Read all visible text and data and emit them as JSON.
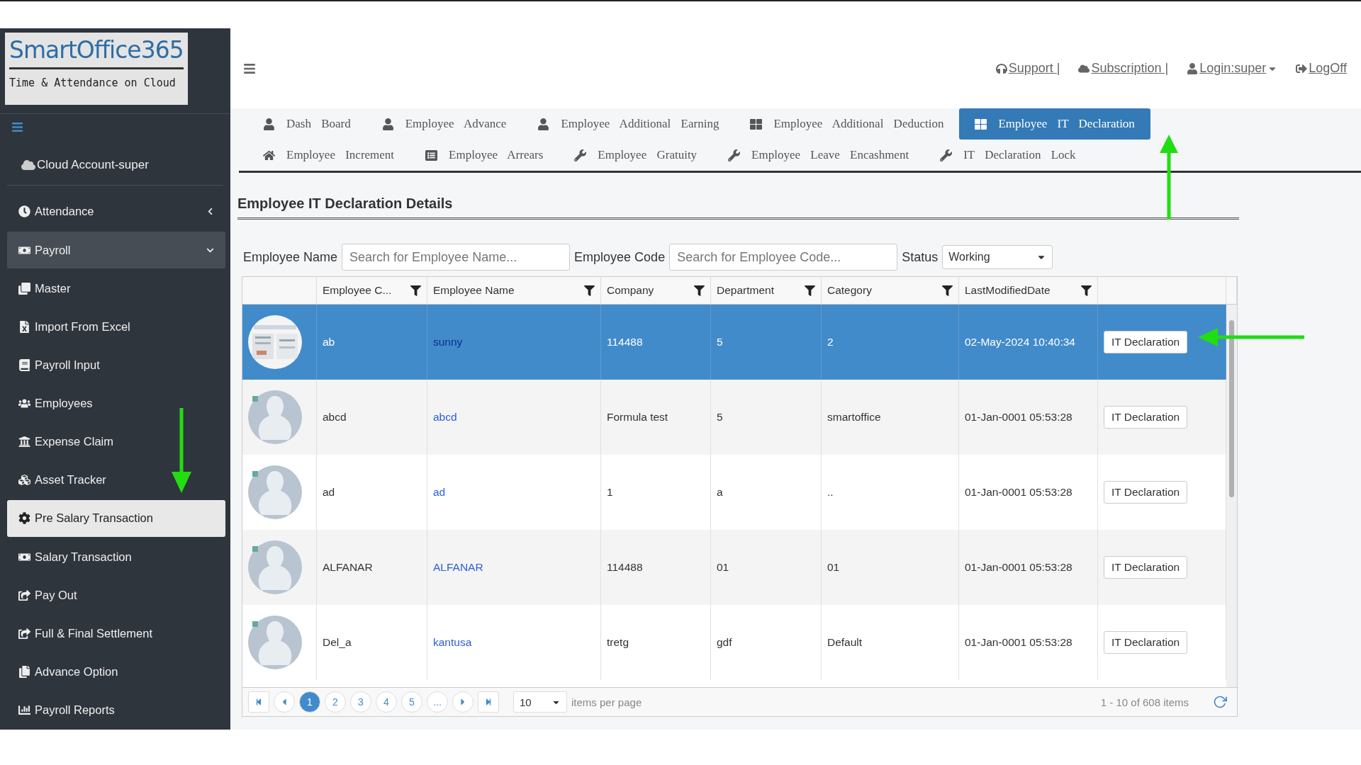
{
  "logo": {
    "title": "SmartOffice365",
    "subtitle": "Time & Attendance on Cloud"
  },
  "account": "Cloud Account-super",
  "sidebar": {
    "items": [
      {
        "label": "Attendance",
        "kind": "group",
        "expanded": false,
        "selected": false
      },
      {
        "label": "Payroll",
        "kind": "group",
        "expanded": true,
        "selected": true
      },
      {
        "label": "Master",
        "kind": "link",
        "selected": false
      },
      {
        "label": "Import From Excel",
        "kind": "link",
        "selected": false
      },
      {
        "label": "Payroll Input",
        "kind": "link",
        "selected": false
      },
      {
        "label": "Employees",
        "kind": "link",
        "selected": false
      },
      {
        "label": "Expense Claim",
        "kind": "link",
        "selected": false
      },
      {
        "label": "Asset Tracker",
        "kind": "link",
        "selected": false
      },
      {
        "label": "Pre Salary Transaction",
        "kind": "link",
        "selected": true
      },
      {
        "label": "Salary Transaction",
        "kind": "link",
        "selected": false
      },
      {
        "label": "Pay Out",
        "kind": "link",
        "selected": false
      },
      {
        "label": "Full & Final Settlement",
        "kind": "link",
        "selected": false
      },
      {
        "label": "Advance Option",
        "kind": "link",
        "selected": false
      },
      {
        "label": "Payroll Reports",
        "kind": "link",
        "selected": false
      }
    ]
  },
  "topbar": {
    "links": [
      "Support |",
      "Subscription |",
      "Login:super",
      "LogOff"
    ]
  },
  "tabs": [
    {
      "label": "Dash Board",
      "selected": false
    },
    {
      "label": "Employee Advance",
      "selected": false
    },
    {
      "label": "Employee Additional Earning",
      "selected": false
    },
    {
      "label": "Employee Additional Deduction",
      "selected": false
    },
    {
      "label": "Employee IT Declaration",
      "selected": true
    },
    {
      "label": "Employee Increment",
      "selected": false
    },
    {
      "label": "Employee Arrears",
      "selected": false
    },
    {
      "label": "Employee Gratuity",
      "selected": false
    },
    {
      "label": "Employee Leave Encashment",
      "selected": false
    },
    {
      "label": "IT Declaration Lock",
      "selected": false
    }
  ],
  "title": "Employee IT Declaration Details",
  "filters": {
    "name_label": "Employee Name",
    "name_placeholder": "Search for Employee Name...",
    "code_label": "Employee Code",
    "code_placeholder": "Search for Employee Code...",
    "status_label": "Status",
    "status_value": "Working"
  },
  "table": {
    "columns": [
      "Employee C...",
      "Employee Name",
      "Company",
      "Department",
      "Category",
      "LastModifiedDate"
    ],
    "rows": [
      {
        "kind": "picture",
        "code": "ab",
        "name": "sunny",
        "company": "114488",
        "department": "5",
        "category": "2",
        "date": "02-May-2024 10:40:34",
        "action": "IT Declaration",
        "selected": true
      },
      {
        "kind": "placeholder",
        "code": "abcd",
        "name": "abcd",
        "company": "Formula test",
        "department": "5",
        "category": "smartoffice",
        "date": "01-Jan-0001 05:53:28",
        "action": "IT Declaration",
        "selected": false
      },
      {
        "kind": "placeholder",
        "code": "ad",
        "name": "ad",
        "company": "1",
        "department": "a",
        "category": "..",
        "date": "01-Jan-0001 05:53:28",
        "action": "IT Declaration",
        "selected": false
      },
      {
        "kind": "placeholder",
        "code": "ALFANAR",
        "name": "ALFANAR",
        "company": "114488",
        "department": "01",
        "category": "01",
        "date": "01-Jan-0001 05:53:28",
        "action": "IT Declaration",
        "selected": false
      },
      {
        "kind": "placeholder",
        "code": "Del_a",
        "name": "kantusa",
        "company": "tretg",
        "department": "gdf",
        "category": "Default",
        "date": "01-Jan-0001 05:53:28",
        "action": "IT Declaration",
        "selected": false
      }
    ]
  },
  "pager": {
    "pages": [
      {
        "label": "1",
        "selected": true
      },
      {
        "label": "2",
        "selected": false
      },
      {
        "label": "3",
        "selected": false
      },
      {
        "label": "4",
        "selected": false
      },
      {
        "label": "5",
        "selected": false
      },
      {
        "label": "...",
        "selected": false
      }
    ],
    "per_page": "10",
    "per_page_label": "items per page",
    "summary": "1 - 10 of 608 items"
  }
}
